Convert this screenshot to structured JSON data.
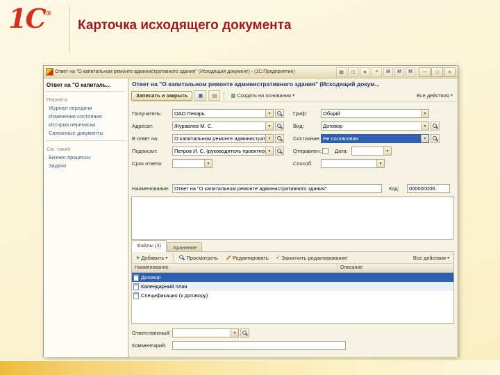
{
  "slide": {
    "logo": "1С",
    "reg": "®",
    "title": "Карточка исходящего документа"
  },
  "icons": {
    "dropdown": "▾",
    "add": "+",
    "finish": "✓",
    "save": "▣",
    "copy": "▤",
    "based_on": "▦"
  },
  "window": {
    "title": "Ответ на \"О капитальном ремонте административного здания\" (Исходящий документ) - (1С:Предприятие)",
    "service_icons": [
      "▦",
      "◫",
      "★",
      "≡"
    ],
    "memory_buttons": [
      "М",
      "М",
      "М"
    ],
    "controls": {
      "min": "─",
      "max": "□",
      "close": "×"
    }
  },
  "sidebar": {
    "header": "Ответ на \"О капиталь...",
    "sections": [
      {
        "title": "Перейти",
        "items": [
          "Журнал передачи",
          "Изменение состояния",
          "История переписки",
          "Связанные документы"
        ]
      },
      {
        "title": "См. также",
        "items": [
          "Бизнес-процессы",
          "Задачи"
        ]
      }
    ]
  },
  "form": {
    "header": "Ответ на \"О капитальном ремонте административного здания\" (Исходящий докум...",
    "toolbar": {
      "save_close": "Записать и закрыть",
      "create_based": "Создать на основании",
      "all_actions": "Все действия"
    },
    "fields_left": [
      {
        "label": "Получатель:",
        "value": "ОАО Пекарь"
      },
      {
        "label": "Адресат:",
        "value": "Журавлев М. С."
      },
      {
        "label": "В ответ на:",
        "value": "О капитальном ремонте административного зд..."
      },
      {
        "label": "Подписал:",
        "value": "Петров И. С. (руководитель проектного бюро)"
      },
      {
        "label": "Срок ответа:",
        "value": ""
      }
    ],
    "fields_right": [
      {
        "label": "Гриф:",
        "value": "Общий"
      },
      {
        "label": "Вид:",
        "value": "Договор"
      },
      {
        "label": "Состояние:",
        "value": "Не согласован"
      },
      {
        "label": "Отправлен:",
        "date_label": "Дата:",
        "date_value": ""
      },
      {
        "label": "Способ:",
        "value": ""
      }
    ],
    "name_field": {
      "label": "Наименование:",
      "value": "Ответ на \"О капитальном ремонте административного здания\"",
      "code_label": "Код:",
      "code_value": "000000006"
    },
    "responsible": {
      "label": "Ответственный:",
      "value": ""
    },
    "comment": {
      "label": "Комментарий:",
      "value": ""
    }
  },
  "files": {
    "tabs": [
      {
        "label": "Файлы (3)"
      },
      {
        "label": "Хранение"
      }
    ],
    "toolbar": {
      "add": "Добавить",
      "view": "Просмотреть",
      "edit": "Редактировать",
      "finish": "Закончить редактирование",
      "all_actions": "Все действия"
    },
    "columns": [
      "Наименование",
      "Описание"
    ],
    "rows": [
      {
        "name": "Договор",
        "description": ""
      },
      {
        "name": "Календарный план",
        "description": ""
      },
      {
        "name": "Спецификация (к договору)",
        "description": ""
      }
    ]
  }
}
